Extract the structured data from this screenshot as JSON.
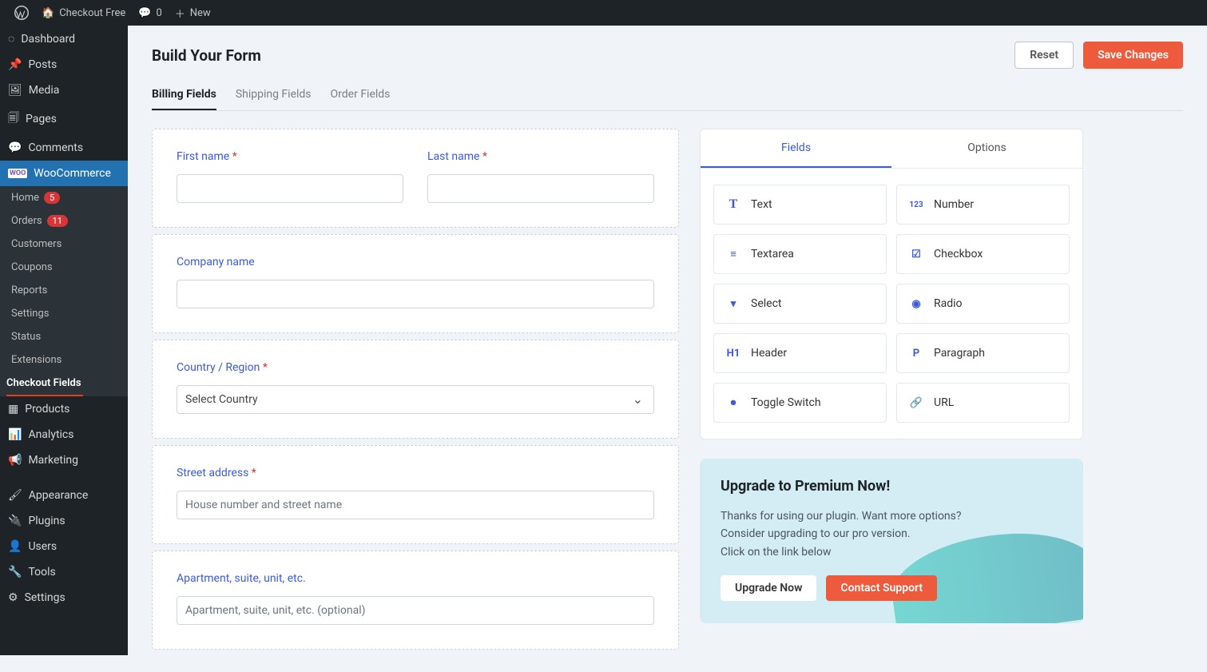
{
  "adminbar": {
    "site": "Checkout Free",
    "comments": "0",
    "new": "New"
  },
  "sidebar": {
    "items": [
      {
        "label": "Dashboard"
      },
      {
        "label": "Posts"
      },
      {
        "label": "Media"
      },
      {
        "label": "Pages"
      },
      {
        "label": "Comments"
      },
      {
        "label": "WooCommerce"
      },
      {
        "label": "Products"
      },
      {
        "label": "Analytics"
      },
      {
        "label": "Marketing"
      },
      {
        "label": "Appearance"
      },
      {
        "label": "Plugins"
      },
      {
        "label": "Users"
      },
      {
        "label": "Tools"
      },
      {
        "label": "Settings"
      }
    ],
    "woosub": [
      {
        "label": "Home",
        "badge": "5"
      },
      {
        "label": "Orders",
        "badge": "11"
      },
      {
        "label": "Customers"
      },
      {
        "label": "Coupons"
      },
      {
        "label": "Reports"
      },
      {
        "label": "Settings"
      },
      {
        "label": "Status"
      },
      {
        "label": "Extensions"
      },
      {
        "label": "Checkout Fields"
      }
    ]
  },
  "header": {
    "title": "Build Your Form",
    "reset": "Reset",
    "save": "Save Changes"
  },
  "tabs": [
    "Billing Fields",
    "Shipping Fields",
    "Order Fields"
  ],
  "form": {
    "first_name": "First name",
    "last_name": "Last name",
    "company": "Company name",
    "country": "Country / Region",
    "country_placeholder": "Select Country",
    "street": "Street address",
    "street_placeholder": "House number and street name",
    "apt": "Apartment, suite, unit, etc.",
    "apt_placeholder": "Apartment, suite, unit, etc. (optional)"
  },
  "rightTabs": [
    "Fields",
    "Options"
  ],
  "fieldTypes": [
    {
      "label": "Text",
      "icon": "T"
    },
    {
      "label": "Number",
      "icon": "123"
    },
    {
      "label": "Textarea",
      "icon": "≡"
    },
    {
      "label": "Checkbox",
      "icon": "☑"
    },
    {
      "label": "Select",
      "icon": "▭"
    },
    {
      "label": "Radio",
      "icon": "◉"
    },
    {
      "label": "Header",
      "icon": "H1"
    },
    {
      "label": "Paragraph",
      "icon": "P"
    },
    {
      "label": "Toggle Switch",
      "icon": "⏺"
    },
    {
      "label": "URL",
      "icon": "🔗"
    }
  ],
  "upgrade": {
    "title": "Upgrade to Premium Now!",
    "body": "Thanks for using our plugin. Want more options?\nConsider upgrading to our pro version.\nClick on the link below",
    "btn1": "Upgrade Now",
    "btn2": "Contact Support"
  }
}
